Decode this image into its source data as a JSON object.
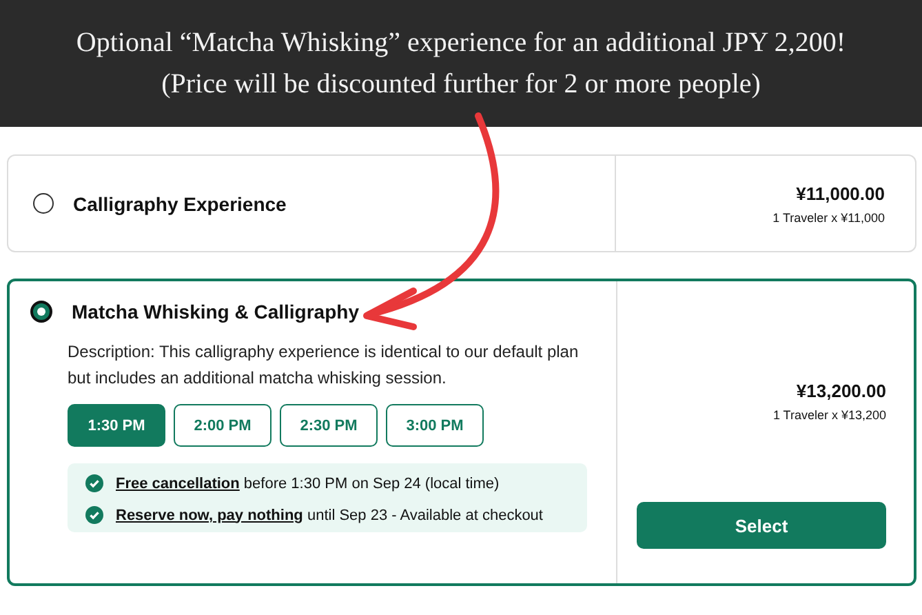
{
  "banner": {
    "lines": [
      "Optional “Matcha Whisking” experience for an additional JPY 2,200!",
      "(Price will be discounted further for 2 or more people)"
    ]
  },
  "options": [
    {
      "name": "Calligraphy Experience",
      "selected": false,
      "price": "¥11,000.00",
      "price_detail": "1 Traveler x ¥11,000"
    },
    {
      "name": "Matcha Whisking & Calligraphy",
      "selected": true,
      "description": "Description: This calligraphy experience is identical to our default plan but includes an additional matcha whisking session.",
      "times": [
        {
          "label": "1:30 PM",
          "selected": true
        },
        {
          "label": "2:00 PM",
          "selected": false
        },
        {
          "label": "2:30 PM",
          "selected": false
        },
        {
          "label": "3:00 PM",
          "selected": false
        }
      ],
      "benefits": [
        {
          "link": "Free cancellation",
          "text": "before 1:30 PM on Sep 24 (local time)"
        },
        {
          "link": "Reserve now, pay nothing",
          "text": "until Sep 23 - Available at checkout"
        }
      ],
      "price": "¥13,200.00",
      "price_detail": "1 Traveler x ¥13,200",
      "button": "Select"
    }
  ]
}
